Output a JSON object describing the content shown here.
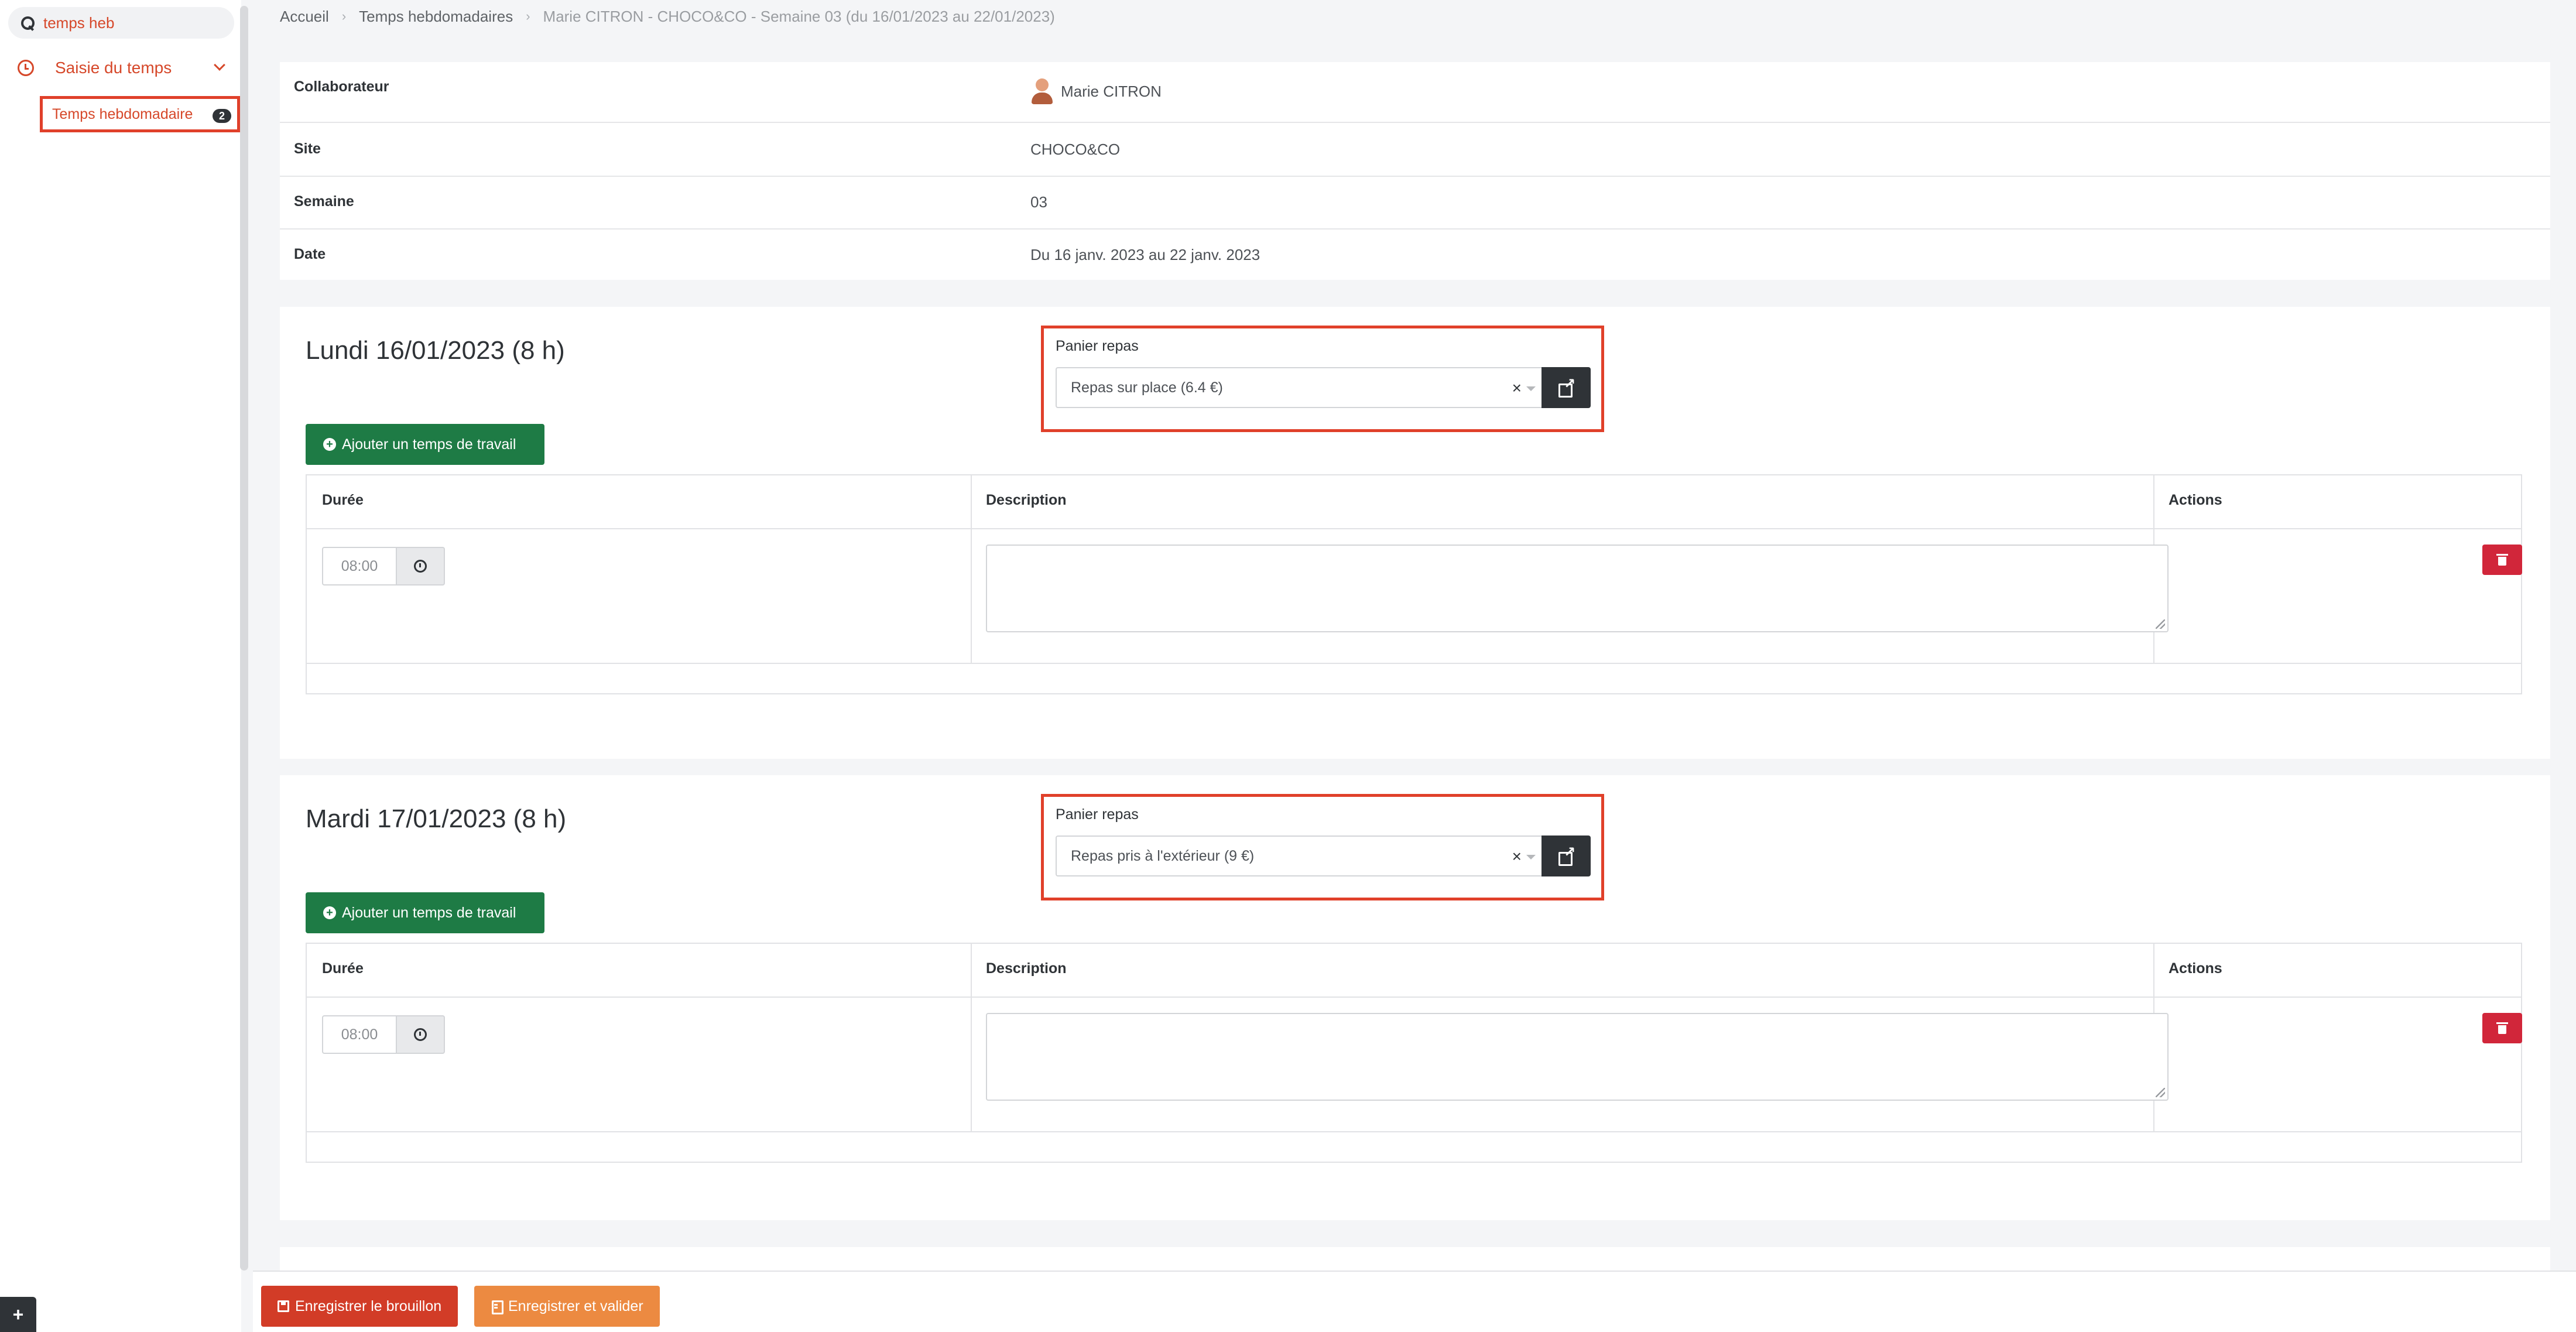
{
  "sidebar": {
    "search_value": "temps heb",
    "group_label": "Saisie du temps",
    "sub_item_label": "Temps hebdomadaire",
    "sub_item_badge": "2",
    "plus_label": "+"
  },
  "breadcrumb": {
    "home": "Accueil",
    "section": "Temps hebdomadaires",
    "current": "Marie CITRON - CHOCO&CO - Semaine 03 (du 16/01/2023 au 22/01/2023)"
  },
  "info": {
    "collaborateur_label": "Collaborateur",
    "collaborateur_value": "Marie CITRON",
    "site_label": "Site",
    "site_value": "CHOCO&CO",
    "semaine_label": "Semaine",
    "semaine_value": "03",
    "date_label": "Date",
    "date_value": "Du 16 janv. 2023 au 22 janv. 2023"
  },
  "days": [
    {
      "title": "Lundi 16/01/2023 (8 h)",
      "panier_label": "Panier repas",
      "panier_value": "Repas sur place (6.4 €)",
      "clear_label": "×",
      "add_label": "Ajouter un temps de travail",
      "col_duree": "Durée",
      "col_description": "Description",
      "col_actions": "Actions",
      "duration": "08:00"
    },
    {
      "title": "Mardi 17/01/2023 (8 h)",
      "panier_label": "Panier repas",
      "panier_value": "Repas pris à l'extérieur (9 €)",
      "clear_label": "×",
      "add_label": "Ajouter un temps de travail",
      "col_duree": "Durée",
      "col_description": "Description",
      "col_actions": "Actions",
      "duration": "08:00"
    }
  ],
  "footer": {
    "draft_label": "Enregistrer le brouillon",
    "validate_label": "Enregistrer et valider"
  },
  "colors": {
    "accent": "#d6482a",
    "highlight_border": "#e0402a",
    "add_button": "#1e7b45",
    "delete_button": "#d1263a",
    "draft_button": "#d23c27",
    "validate_button": "#ec8a41",
    "dark": "#2f3337"
  }
}
